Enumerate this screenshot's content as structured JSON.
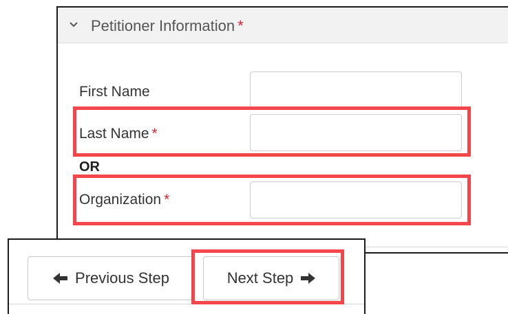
{
  "panel": {
    "title": "Petitioner Information",
    "required_marker": "*"
  },
  "fields": {
    "first_name": {
      "label": "First Name",
      "value": ""
    },
    "last_name": {
      "label": "Last Name",
      "required_marker": "*",
      "value": ""
    },
    "or_label": "OR",
    "organization": {
      "label": "Organization",
      "required_marker": "*",
      "value": ""
    }
  },
  "navigation": {
    "previous_label": "Previous Step",
    "next_label": "Next Step"
  },
  "icons": {
    "collapse": "chevron-down-icon",
    "previous": "arrow-left-icon",
    "next": "arrow-right-icon"
  },
  "colors": {
    "required": "#d9232e",
    "highlight": "#f2464a",
    "header_bg": "#f2f2f2"
  }
}
